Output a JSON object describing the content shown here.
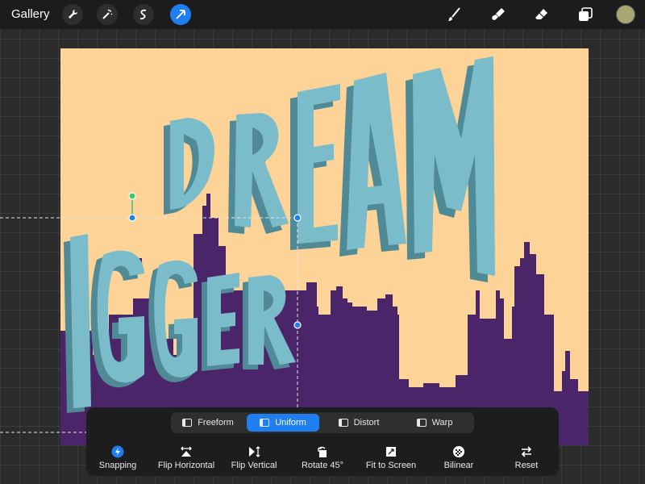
{
  "toolbar": {
    "gallery_label": "Gallery",
    "left_tools": [
      "wrench-icon",
      "magic-wand-icon",
      "selection-icon",
      "transform-arrow-icon"
    ],
    "active_tool": "transform-arrow-icon",
    "right_tools": [
      "brush-icon",
      "smudge-icon",
      "eraser-icon",
      "layers-icon"
    ],
    "current_color": "#a8a774"
  },
  "canvas": {
    "background_color": "#fdd397",
    "artwork_text": [
      "DREAM",
      "IGGER"
    ],
    "colors": {
      "letters": "#7bbcca",
      "letter_shadow": "#4f8a96",
      "city": "#4a2569"
    }
  },
  "transform_panel": {
    "modes": [
      {
        "label": "Freeform",
        "active": false
      },
      {
        "label": "Uniform",
        "active": true
      },
      {
        "label": "Distort",
        "active": false
      },
      {
        "label": "Warp",
        "active": false
      }
    ],
    "actions": [
      {
        "label": "Snapping",
        "icon": "snapping-icon",
        "active": true
      },
      {
        "label": "Flip Horizontal",
        "icon": "flip-horizontal-icon"
      },
      {
        "label": "Flip Vertical",
        "icon": "flip-vertical-icon"
      },
      {
        "label": "Rotate 45°",
        "icon": "rotate-icon"
      },
      {
        "label": "Fit to Screen",
        "icon": "fit-to-screen-icon"
      },
      {
        "label": "Bilinear",
        "icon": "bilinear-icon"
      },
      {
        "label": "Reset",
        "icon": "reset-icon"
      }
    ],
    "accent_color": "#1f7ef0"
  }
}
